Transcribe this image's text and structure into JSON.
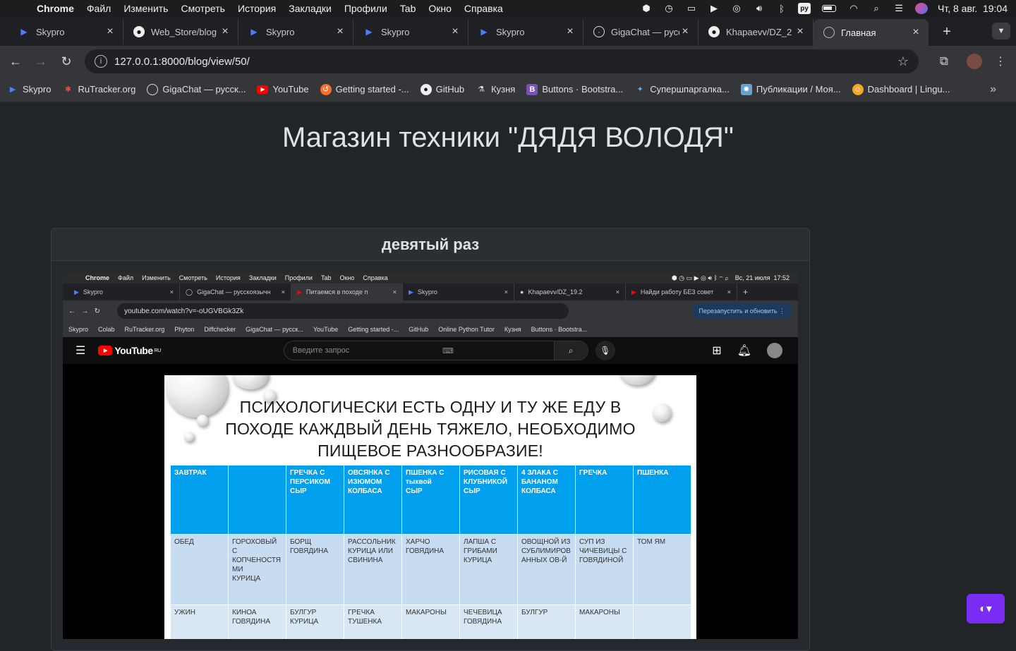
{
  "menubar": {
    "app": "Chrome",
    "items": [
      "Файл",
      "Изменить",
      "Смотреть",
      "История",
      "Закладки",
      "Профили",
      "Tab",
      "Окно",
      "Справка"
    ],
    "datetime": "Чт, 8 авг.  19:04",
    "input_lang": "ру"
  },
  "tabs": [
    {
      "title": "Skypro",
      "icon": "skypro-icon"
    },
    {
      "title": "Web_Store/blog",
      "icon": "github-icon"
    },
    {
      "title": "Skypro",
      "icon": "skypro-icon"
    },
    {
      "title": "Skypro",
      "icon": "skypro-icon"
    },
    {
      "title": "Skypro",
      "icon": "skypro-icon"
    },
    {
      "title": "GigaChat — русс",
      "icon": "gigachat-icon"
    },
    {
      "title": "Khapaevv/DZ_2",
      "icon": "github-icon"
    },
    {
      "title": "Главная",
      "icon": "globe-icon",
      "active": true
    }
  ],
  "address": {
    "url": "127.0.0.1:8000/blog/view/50/"
  },
  "bookmarks": [
    {
      "label": "Skypro"
    },
    {
      "label": "RuTracker.org"
    },
    {
      "label": "GigaChat — русск..."
    },
    {
      "label": "YouTube"
    },
    {
      "label": "Getting started -..."
    },
    {
      "label": "GitHub"
    },
    {
      "label": "Кузня"
    },
    {
      "label": "Buttons · Bootstra..."
    },
    {
      "label": "Супершпаргалка..."
    },
    {
      "label": "Публикации / Моя..."
    },
    {
      "label": "Dashboard | Lingu..."
    }
  ],
  "page": {
    "site_title": "Магазин техники \"ДЯДЯ ВОЛОДЯ\"",
    "post_title": "девятый раз"
  },
  "inner": {
    "menubar": {
      "app": "Chrome",
      "items": [
        "Файл",
        "Изменить",
        "Смотреть",
        "История",
        "Закладки",
        "Профили",
        "Tab",
        "Окно",
        "Справка"
      ],
      "datetime": "Вс, 21 июля  17:52"
    },
    "tabs": [
      "Skypro",
      "GigaChat — русскоязычн",
      "Питаемся в походе п",
      "Skypro",
      "Khapaevv/DZ_19.2",
      "Найди работу БЕЗ совет"
    ],
    "url": "youtube.com/watch?v=-oUGVBGk3Zk",
    "update_button": "Перезапустить и обновить",
    "bookmarks": [
      "Skypro",
      "Colab",
      "RuTracker.org",
      "Phyton",
      "Diffchecker",
      "GigaChat — русск...",
      "YouTube",
      "Getting started -...",
      "GitHub",
      "Online Python Tutor",
      "Кузня",
      "Buttons · Bootstra..."
    ],
    "youtube": {
      "logo": "YouTube",
      "region": "RU",
      "search_placeholder": "Введите запрос"
    },
    "video": {
      "title_lines": [
        "ПСИХОЛОГИЧЕСКИ ЕСТЬ ОДНУ И ТУ ЖЕ ЕДУ В",
        "ПОХОДЕ КАЖДВЫЙ ДЕНЬ ТЯЖЕЛО, НЕОБХОДИМО",
        "ПИЩЕВОЕ РАЗНООБРАЗИЕ!"
      ],
      "table": [
        [
          "ЗАВТРАК",
          "",
          "ГРЕЧКА С\nПЕРСИКОМ\nСЫР",
          "ОВСЯНКА С\nИЗЮМОМ\nКОЛБАСА",
          "ПШЕНКА С\nтыквой\nСЫР",
          "РИСОВАЯ С\nКЛУБНИКОЙ\nСЫР",
          "4 ЗЛАКА С\nБАНАНОМ\nКОЛБАСА",
          "ГРЕЧКА",
          "ПШЕНКА"
        ],
        [
          "ОБЕД",
          "ГОРОХОВЫЙ С\nКОПЧЕНОСТЯ\nМИ\nКУРИЦА",
          "БОРЩ\nГОВЯДИНА",
          "РАССОЛЬНИК\nКУРИЦА ИЛИ\nСВИНИНА",
          "ХАРЧО\nГОВЯДИНА",
          "ЛАПША С\nГРИБАМИ\nКУРИЦА",
          "ОВОЩНОЙ ИЗ\nСУБЛИМИРОВ\nАННЫХ ОВ-Й",
          "СУП ИЗ\nЧИЧЕВИЦЫ С\nГОВЯДИНОЙ",
          "ТОМ ЯМ"
        ],
        [
          "УЖИН",
          "КИНОА\nГОВЯДИНА",
          "БУЛГУР\nКУРИЦА",
          "ГРЕЧКА\nТУШЕНКА",
          "МАКАРОНЫ",
          "ЧЕЧЕВИЦА\nГОВЯДИНА",
          "БУЛГУР",
          "МАКАРОНЫ",
          ""
        ]
      ]
    }
  },
  "colors": {
    "accent": "#7a2cf2",
    "table_header": "#00a0ee",
    "page_bg": "#222528"
  }
}
